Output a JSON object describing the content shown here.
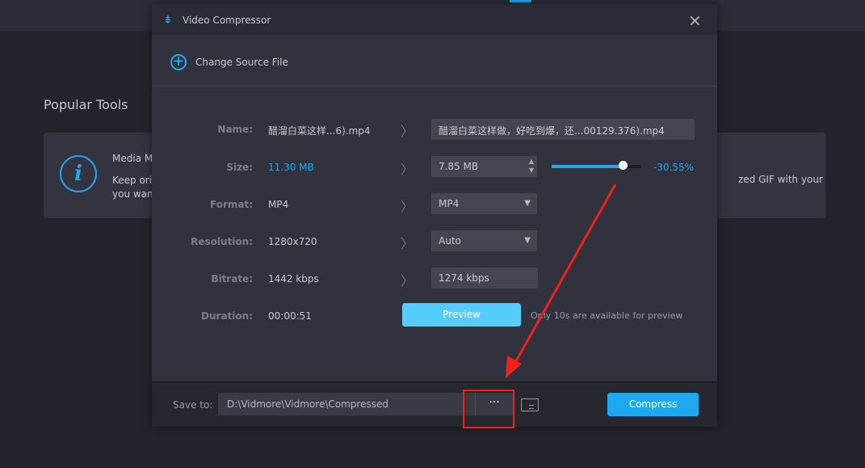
{
  "background": {
    "section_title": "Popular Tools",
    "card_title": "Media M",
    "card_desc_left": "Keep orig you want",
    "card_desc_right": "zed GIF with your"
  },
  "dialog": {
    "title": "Video Compressor",
    "change_source": "Change Source File",
    "labels": {
      "name": "Name:",
      "size": "Size:",
      "format": "Format:",
      "resolution": "Resolution:",
      "bitrate": "Bitrate:",
      "duration": "Duration:"
    },
    "source": {
      "name": "醋溜白菜这样...6).mp4",
      "size": "11.30 MB",
      "format": "MP4",
      "resolution": "1280x720",
      "bitrate": "1442 kbps",
      "duration": "00:00:51"
    },
    "output": {
      "name": "醋溜白菜这样做，好吃到爆，还...00129.376).mp4",
      "size": "7.85 MB",
      "format": "MP4",
      "resolution": "Auto",
      "bitrate": "1274 kbps"
    },
    "slider_fraction": 0.79,
    "percent": "-30.55%",
    "preview_label": "Preview",
    "preview_note": "Only 10s are available for preview",
    "save_to_label": "Save to:",
    "save_path": "D:\\Vidmore\\Vidmore\\Compressed",
    "more_label": "···",
    "compress_label": "Compress"
  },
  "colors": {
    "accent": "#1ea8ee",
    "annotation": "#f0201a"
  }
}
